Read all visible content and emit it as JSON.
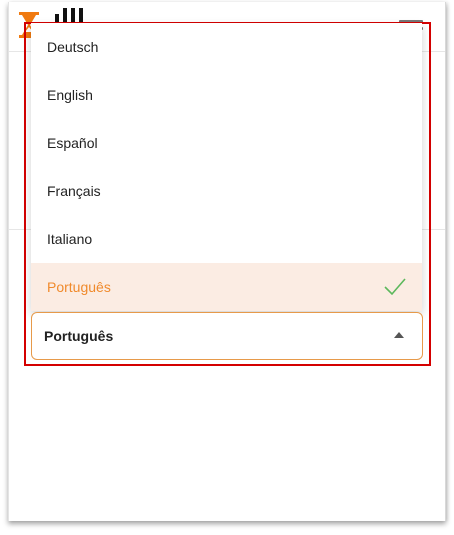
{
  "brand": {
    "logo_icon": "hourglass-logo",
    "logo_color": "#f07a10"
  },
  "header": {
    "menu_icon": "hamburger-menu-icon"
  },
  "language_select": {
    "options": [
      "Deutsch",
      "English",
      "Español",
      "Français",
      "Italiano",
      "Português"
    ],
    "selected_index": 5,
    "selected_value": "Português",
    "accent_color": "#f08a2c",
    "selected_bg": "#fbece3",
    "check_color": "#5cb85c",
    "caret_icon": "caret-up-icon"
  },
  "annotation": {
    "highlight_color": "#d40000"
  }
}
